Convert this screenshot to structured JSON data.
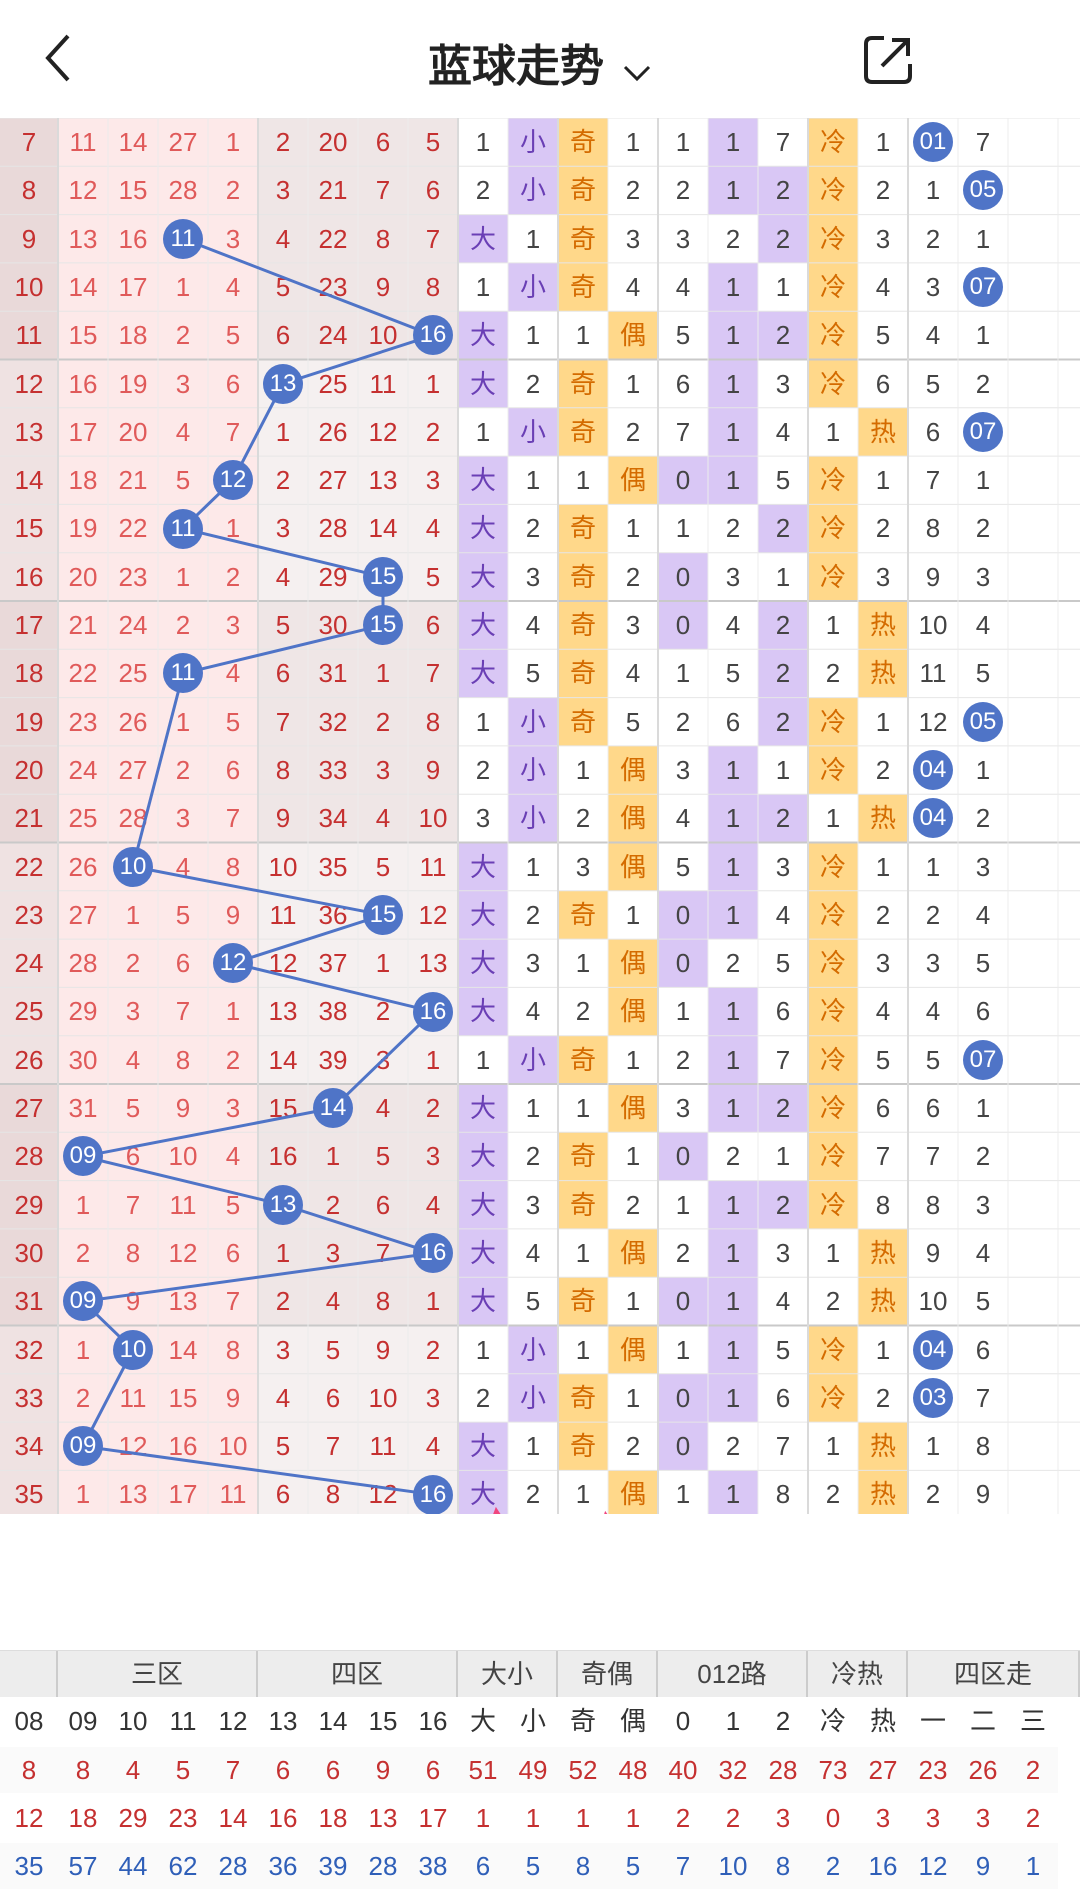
{
  "header": {
    "title": "蓝球走势",
    "back_icon": "chevron-left-icon",
    "dropdown_icon": "chevron-down-icon",
    "share_icon": "share-icon"
  },
  "rows": [
    {
      "z1": "7",
      "z2": [
        "11",
        "14",
        "27",
        "1"
      ],
      "z3": [
        "2",
        "20",
        "6",
        "5"
      ],
      "dx": "1",
      "xs": "小",
      "oe": "奇",
      "ev": "1",
      "r0": "1",
      "r1": "1",
      "r2": "7",
      "ch": "冷",
      "hot": "1",
      "q1": "01",
      "q2": "7"
    },
    {
      "z1": "8",
      "z2": [
        "12",
        "15",
        "28",
        "2"
      ],
      "z3": [
        "3",
        "21",
        "7",
        "6"
      ],
      "dx": "2",
      "xs": "小",
      "oe": "奇",
      "ev": "2",
      "r0": "2",
      "r1": "1",
      "r2": "2",
      "ch": "冷",
      "hot": "2",
      "q1": "1",
      "q2": "05"
    },
    {
      "z1": "9",
      "z2": [
        "13",
        "16",
        "11",
        "3"
      ],
      "z3": [
        "4",
        "22",
        "8",
        "7"
      ],
      "dx": "大",
      "xs": "1",
      "oe": "奇",
      "ev": "3",
      "r0": "3",
      "r1": "2",
      "r2": "2",
      "ch": "冷",
      "hot": "3",
      "q1": "2",
      "q2": "1"
    },
    {
      "z1": "10",
      "z2": [
        "14",
        "17",
        "1",
        "4"
      ],
      "z3": [
        "5",
        "23",
        "9",
        "8"
      ],
      "dx": "1",
      "xs": "小",
      "oe": "奇",
      "ev": "4",
      "r0": "4",
      "r1": "1",
      "r2": "1",
      "ch": "冷",
      "hot": "4",
      "q1": "3",
      "q2": "07"
    },
    {
      "z1": "11",
      "z2": [
        "15",
        "18",
        "2",
        "5"
      ],
      "z3": [
        "6",
        "24",
        "10",
        "16"
      ],
      "dx": "大",
      "xs": "1",
      "oe": "1",
      "ev": "偶",
      "r0": "5",
      "r1": "1",
      "r2": "2",
      "ch": "冷",
      "hot": "5",
      "q1": "4",
      "q2": "1"
    },
    {
      "z1": "12",
      "z2": [
        "16",
        "19",
        "3",
        "6"
      ],
      "z3": [
        "13",
        "25",
        "11",
        "1"
      ],
      "dx": "大",
      "xs": "2",
      "oe": "奇",
      "ev": "1",
      "r0": "6",
      "r1": "1",
      "r2": "3",
      "ch": "冷",
      "hot": "6",
      "q1": "5",
      "q2": "2"
    },
    {
      "z1": "13",
      "z2": [
        "17",
        "20",
        "4",
        "7"
      ],
      "z3": [
        "1",
        "26",
        "12",
        "2"
      ],
      "dx": "1",
      "xs": "小",
      "oe": "奇",
      "ev": "2",
      "r0": "7",
      "r1": "1",
      "r2": "4",
      "ch": "1",
      "hot": "热",
      "q1": "6",
      "q2": "07"
    },
    {
      "z1": "14",
      "z2": [
        "18",
        "21",
        "5",
        "12"
      ],
      "z3": [
        "2",
        "27",
        "13",
        "3"
      ],
      "dx": "大",
      "xs": "1",
      "oe": "1",
      "ev": "偶",
      "r0": "0",
      "r1": "1",
      "r2": "5",
      "ch": "冷",
      "hot": "1",
      "q1": "7",
      "q2": "1"
    },
    {
      "z1": "15",
      "z2": [
        "19",
        "22",
        "11",
        "1"
      ],
      "z3": [
        "3",
        "28",
        "14",
        "4"
      ],
      "dx": "大",
      "xs": "2",
      "oe": "奇",
      "ev": "1",
      "r0": "1",
      "r1": "2",
      "r2": "2",
      "ch": "冷",
      "hot": "2",
      "q1": "8",
      "q2": "2"
    },
    {
      "z1": "16",
      "z2": [
        "20",
        "23",
        "1",
        "2"
      ],
      "z3": [
        "4",
        "29",
        "15",
        "5"
      ],
      "dx": "大",
      "xs": "3",
      "oe": "奇",
      "ev": "2",
      "r0": "0",
      "r1": "3",
      "r2": "1",
      "ch": "冷",
      "hot": "3",
      "q1": "9",
      "q2": "3"
    },
    {
      "z1": "17",
      "z2": [
        "21",
        "24",
        "2",
        "3"
      ],
      "z3": [
        "5",
        "30",
        "15",
        "6"
      ],
      "dx": "大",
      "xs": "4",
      "oe": "奇",
      "ev": "3",
      "r0": "0",
      "r1": "4",
      "r2": "2",
      "ch": "1",
      "hot": "热",
      "q1": "10",
      "q2": "4"
    },
    {
      "z1": "18",
      "z2": [
        "22",
        "25",
        "11",
        "4"
      ],
      "z3": [
        "6",
        "31",
        "1",
        "7"
      ],
      "dx": "大",
      "xs": "5",
      "oe": "奇",
      "ev": "4",
      "r0": "1",
      "r1": "5",
      "r2": "2",
      "ch": "2",
      "hot": "热",
      "q1": "11",
      "q2": "5"
    },
    {
      "z1": "19",
      "z2": [
        "23",
        "26",
        "1",
        "5"
      ],
      "z3": [
        "7",
        "32",
        "2",
        "8"
      ],
      "dx": "1",
      "xs": "小",
      "oe": "奇",
      "ev": "5",
      "r0": "2",
      "r1": "6",
      "r2": "2",
      "ch": "冷",
      "hot": "1",
      "q1": "12",
      "q2": "05"
    },
    {
      "z1": "20",
      "z2": [
        "24",
        "27",
        "2",
        "6"
      ],
      "z3": [
        "8",
        "33",
        "3",
        "9"
      ],
      "dx": "2",
      "xs": "小",
      "oe": "1",
      "ev": "偶",
      "r0": "3",
      "r1": "1",
      "r2": "1",
      "ch": "冷",
      "hot": "2",
      "q1": "04",
      "q2": "1"
    },
    {
      "z1": "21",
      "z2": [
        "25",
        "28",
        "3",
        "7"
      ],
      "z3": [
        "9",
        "34",
        "4",
        "10"
      ],
      "dx": "3",
      "xs": "小",
      "oe": "2",
      "ev": "偶",
      "r0": "4",
      "r1": "1",
      "r2": "2",
      "ch": "1",
      "hot": "热",
      "q1": "04",
      "q2": "2"
    },
    {
      "z1": "22",
      "z2": [
        "26",
        "10",
        "4",
        "8"
      ],
      "z3": [
        "10",
        "35",
        "5",
        "11"
      ],
      "dx": "大",
      "xs": "1",
      "oe": "3",
      "ev": "偶",
      "r0": "5",
      "r1": "1",
      "r2": "3",
      "ch": "冷",
      "hot": "1",
      "q1": "1",
      "q2": "3"
    },
    {
      "z1": "23",
      "z2": [
        "27",
        "1",
        "5",
        "9"
      ],
      "z3": [
        "11",
        "36",
        "15",
        "12"
      ],
      "dx": "大",
      "xs": "2",
      "oe": "奇",
      "ev": "1",
      "r0": "0",
      "r1": "1",
      "r2": "4",
      "ch": "冷",
      "hot": "2",
      "q1": "2",
      "q2": "4"
    },
    {
      "z1": "24",
      "z2": [
        "28",
        "2",
        "6",
        "12"
      ],
      "z3": [
        "12",
        "37",
        "1",
        "13"
      ],
      "dx": "大",
      "xs": "3",
      "oe": "1",
      "ev": "偶",
      "r0": "0",
      "r1": "2",
      "r2": "5",
      "ch": "冷",
      "hot": "3",
      "q1": "3",
      "q2": "5"
    },
    {
      "z1": "25",
      "z2": [
        "29",
        "3",
        "7",
        "1"
      ],
      "z3": [
        "13",
        "38",
        "2",
        "16"
      ],
      "dx": "大",
      "xs": "4",
      "oe": "2",
      "ev": "偶",
      "r0": "1",
      "r1": "1",
      "r2": "6",
      "ch": "冷",
      "hot": "4",
      "q1": "4",
      "q2": "6"
    },
    {
      "z1": "26",
      "z2": [
        "30",
        "4",
        "8",
        "2"
      ],
      "z3": [
        "14",
        "39",
        "3",
        "1"
      ],
      "dx": "1",
      "xs": "小",
      "oe": "奇",
      "ev": "1",
      "r0": "2",
      "r1": "1",
      "r2": "7",
      "ch": "冷",
      "hot": "5",
      "q1": "5",
      "q2": "07"
    },
    {
      "z1": "27",
      "z2": [
        "31",
        "5",
        "9",
        "3"
      ],
      "z3": [
        "15",
        "14",
        "4",
        "2"
      ],
      "dx": "大",
      "xs": "1",
      "oe": "1",
      "ev": "偶",
      "r0": "3",
      "r1": "1",
      "r2": "2",
      "ch": "冷",
      "hot": "6",
      "q1": "6",
      "q2": "1"
    },
    {
      "z1": "28",
      "z2": [
        "09",
        "6",
        "10",
        "4"
      ],
      "z3": [
        "16",
        "1",
        "5",
        "3"
      ],
      "dx": "大",
      "xs": "2",
      "oe": "奇",
      "ev": "1",
      "r0": "0",
      "r1": "2",
      "r2": "1",
      "ch": "冷",
      "hot": "7",
      "q1": "7",
      "q2": "2"
    },
    {
      "z1": "29",
      "z2": [
        "1",
        "7",
        "11",
        "5"
      ],
      "z3": [
        "13",
        "2",
        "6",
        "4"
      ],
      "dx": "大",
      "xs": "3",
      "oe": "奇",
      "ev": "2",
      "r0": "1",
      "r1": "1",
      "r2": "2",
      "ch": "冷",
      "hot": "8",
      "q1": "8",
      "q2": "3"
    },
    {
      "z1": "30",
      "z2": [
        "2",
        "8",
        "12",
        "6"
      ],
      "z3": [
        "1",
        "3",
        "7",
        "16"
      ],
      "dx": "大",
      "xs": "4",
      "oe": "1",
      "ev": "偶",
      "r0": "2",
      "r1": "1",
      "r2": "3",
      "ch": "1",
      "hot": "热",
      "q1": "9",
      "q2": "4"
    },
    {
      "z1": "31",
      "z2": [
        "09",
        "9",
        "13",
        "7"
      ],
      "z3": [
        "2",
        "4",
        "8",
        "1"
      ],
      "dx": "大",
      "xs": "5",
      "oe": "奇",
      "ev": "1",
      "r0": "0",
      "r1": "1",
      "r2": "4",
      "ch": "2",
      "hot": "热",
      "q1": "10",
      "q2": "5"
    },
    {
      "z1": "32",
      "z2": [
        "1",
        "10",
        "14",
        "8"
      ],
      "z3": [
        "3",
        "5",
        "9",
        "2"
      ],
      "dx": "1",
      "xs": "小",
      "oe": "1",
      "ev": "偶",
      "r0": "1",
      "r1": "1",
      "r2": "5",
      "ch": "冷",
      "hot": "1",
      "q1": "04",
      "q2": "6"
    },
    {
      "z1": "33",
      "z2": [
        "2",
        "11",
        "15",
        "9"
      ],
      "z3": [
        "4",
        "6",
        "10",
        "3"
      ],
      "dx": "2",
      "xs": "小",
      "oe": "奇",
      "ev": "1",
      "r0": "0",
      "r1": "1",
      "r2": "6",
      "ch": "冷",
      "hot": "2",
      "q1": "03",
      "q2": "7"
    },
    {
      "z1": "34",
      "z2": [
        "09",
        "12",
        "16",
        "10"
      ],
      "z3": [
        "5",
        "7",
        "11",
        "4"
      ],
      "dx": "大",
      "xs": "1",
      "oe": "奇",
      "ev": "2",
      "r0": "0",
      "r1": "2",
      "r2": "7",
      "ch": "1",
      "hot": "热",
      "q1": "1",
      "q2": "8"
    },
    {
      "z1": "35",
      "z2": [
        "1",
        "13",
        "17",
        "11"
      ],
      "z3": [
        "6",
        "8",
        "12",
        "16"
      ],
      "dx": "大",
      "xs": "2",
      "oe": "1",
      "ev": "偶",
      "r0": "1",
      "r1": "1",
      "r2": "8",
      "ch": "2",
      "hot": "热",
      "q1": "2",
      "q2": "9"
    }
  ],
  "edge_circles": [
    "1",
    "1",
    "1",
    "1",
    "1",
    "0",
    "0",
    "0"
  ],
  "future_rows": [
    [
      "08",
      "09",
      "10",
      "11",
      "12",
      "13",
      "14",
      "15",
      "16"
    ],
    [
      "08",
      "09",
      "10",
      "11",
      "12",
      "13",
      "14",
      "15",
      "16"
    ],
    [
      "08",
      "09",
      "10",
      "11",
      "12",
      "13",
      "14",
      "15",
      "16"
    ]
  ],
  "footer": {
    "sections": [
      "三区",
      "四区",
      "大小",
      "奇偶",
      "012路",
      "冷热",
      "四区走"
    ],
    "columns": [
      "08",
      "09",
      "10",
      "11",
      "12",
      "13",
      "14",
      "15",
      "16",
      "大",
      "小",
      "奇",
      "偶",
      "0",
      "1",
      "2",
      "冷",
      "热",
      "一区",
      "二区",
      "三"
    ],
    "stat_rows": [
      [
        "8",
        "8",
        "4",
        "5",
        "7",
        "6",
        "6",
        "9",
        "6",
        "51",
        "49",
        "52",
        "48",
        "40",
        "32",
        "28",
        "73",
        "27",
        "23",
        "26",
        "2"
      ],
      [
        "12",
        "18",
        "29",
        "23",
        "14",
        "16",
        "18",
        "13",
        "17",
        "1",
        "1",
        "1",
        "1",
        "2",
        "2",
        "3",
        "0",
        "3",
        "3",
        "3",
        "2"
      ],
      [
        "35",
        "57",
        "44",
        "62",
        "28",
        "36",
        "39",
        "28",
        "38",
        "6",
        "5",
        "8",
        "5",
        "7",
        "10",
        "8",
        "2",
        "16",
        "12",
        "9",
        "1"
      ]
    ]
  },
  "colors": {
    "ball_blue": "#4f74c7",
    "red_text": "#c53030",
    "pink_text": "#e05a5a",
    "purple": "#d9c7f5",
    "orange": "#ffd88a",
    "cold_text": "#e8882a",
    "arrow_pink": "#f0457e"
  }
}
